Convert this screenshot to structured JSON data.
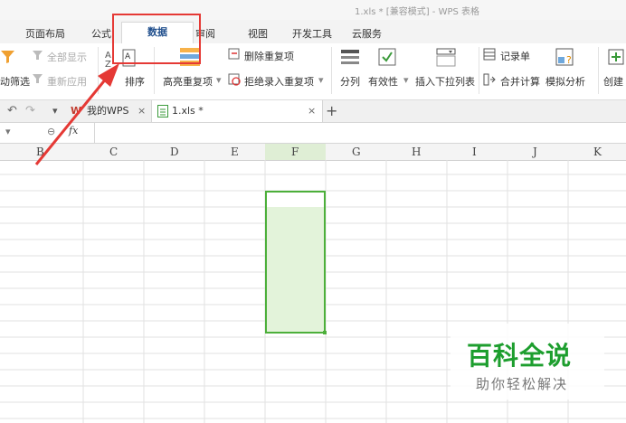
{
  "window": {
    "title": "1.xls * [兼容模式] - WPS 表格"
  },
  "ribbon_tabs": [
    "页面布局",
    "公式",
    "数据",
    "审阅",
    "视图",
    "开发工具",
    "云服务"
  ],
  "ribbon": {
    "show_all": "全部显示",
    "reapply": "重新应用",
    "auto_filter": "动筛选",
    "sort": "排序",
    "highlight_dup": "高亮重复项",
    "remove_dup": "删除重复项",
    "reject_dup": "拒绝录入重复项",
    "split": "分列",
    "validity": "有效性",
    "insert_dropdown": "插入下拉列表",
    "record": "记录单",
    "merge_calc": "合并计算",
    "simulation": "模拟分析",
    "create": "创建"
  },
  "doc_tabs": {
    "home": "我的WPS",
    "file": "1.xls *"
  },
  "formula_bar": {
    "fx": "fx",
    "cell_ref": ""
  },
  "columns": [
    "B",
    "C",
    "D",
    "E",
    "F",
    "G",
    "H",
    "I",
    "J",
    "K"
  ],
  "selection": {
    "column": "F",
    "fill_color": "#e3f3da",
    "border_color": "#4caf3a"
  },
  "watermark": {
    "title": "百科全说",
    "subtitle": "助你轻松解决"
  },
  "colors": {
    "accent": "#e53935",
    "selection": "#4caf3a"
  }
}
